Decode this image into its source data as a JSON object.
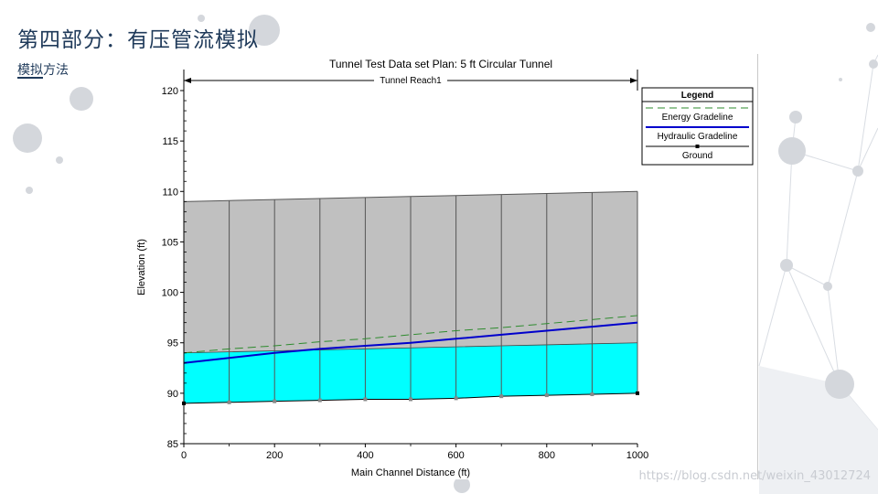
{
  "slide": {
    "title": "第四部分：有压管流模拟",
    "subtitle": "模拟方法",
    "watermark": "https://blog.csdn.net/weixin_43012724"
  },
  "colors": {
    "title": "#1f3a5a",
    "tunnel_fill": "#c0c0c0",
    "water_fill": "#00ffff",
    "energy_line": "#2e8b2e",
    "hydraulic_line": "#0000cc",
    "ground_line": "#000000"
  },
  "chart_data": {
    "type": "line",
    "title": "Tunnel Test Data set      Plan: 5 ft Circular Tunnel",
    "reach_label": "Tunnel Reach1",
    "xlabel": "Main Channel Distance (ft)",
    "ylabel": "Elevation (ft)",
    "xlim": [
      0,
      1000
    ],
    "ylim": [
      85,
      120
    ],
    "xticks": [
      0,
      200,
      400,
      600,
      800,
      1000
    ],
    "yticks": [
      85,
      90,
      95,
      100,
      105,
      110,
      115,
      120
    ],
    "grid": false,
    "legend": {
      "title": "Legend",
      "placement": "right",
      "entries": [
        "Energy Gradeline",
        "Hydraulic Gradeline",
        "Ground"
      ]
    },
    "x": [
      0,
      100,
      200,
      300,
      400,
      500,
      600,
      700,
      800,
      900,
      1000
    ],
    "series": [
      {
        "name": "Energy Gradeline",
        "values": [
          94.0,
          94.4,
          94.7,
          95.1,
          95.4,
          95.8,
          96.2,
          96.5,
          96.9,
          97.3,
          97.7
        ]
      },
      {
        "name": "Hydraulic Gradeline",
        "values": [
          93.0,
          93.5,
          94.0,
          94.4,
          94.7,
          95.0,
          95.4,
          95.8,
          96.2,
          96.6,
          97.0
        ]
      },
      {
        "name": "Ground",
        "values": [
          89.0,
          89.1,
          89.2,
          89.3,
          89.4,
          89.4,
          89.5,
          89.7,
          89.8,
          89.9,
          90.0
        ]
      }
    ],
    "tunnel_top": [
      109.0,
      109.1,
      109.2,
      109.3,
      109.4,
      109.5,
      109.6,
      109.7,
      109.8,
      109.9,
      110.0
    ],
    "water_surface": [
      94.0,
      94.1,
      94.2,
      94.3,
      94.4,
      94.5,
      94.6,
      94.7,
      94.8,
      94.9,
      95.0
    ]
  }
}
